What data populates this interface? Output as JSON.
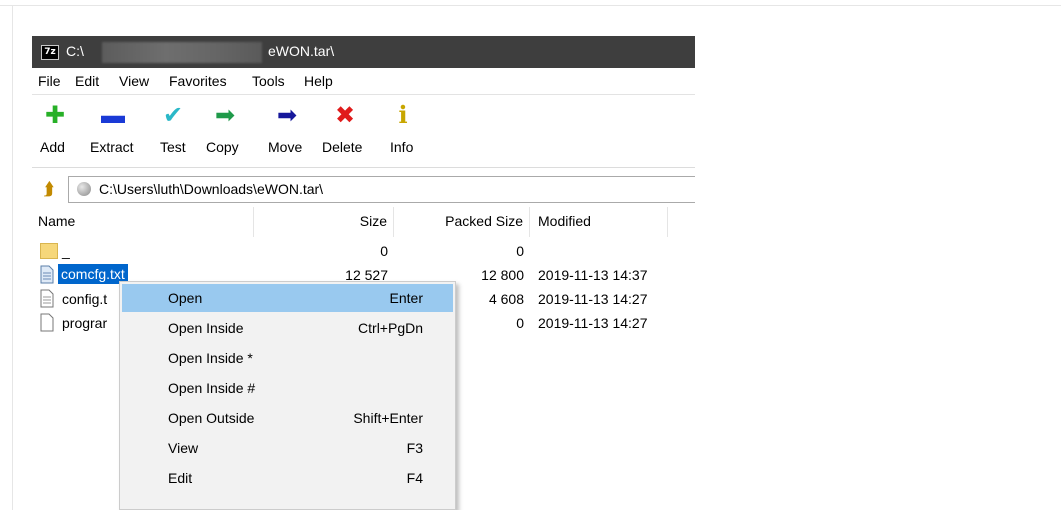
{
  "window": {
    "app_icon_text": "7z",
    "title_prefix": "C:\\",
    "title_suffix": "eWON.tar\\"
  },
  "menu": [
    "File",
    "Edit",
    "View",
    "Favorites",
    "Tools",
    "Help"
  ],
  "toolbar": [
    {
      "label": "Add",
      "icon": "add-icon",
      "glyph": "✚",
      "color": "#27b027"
    },
    {
      "label": "Extract",
      "icon": "extract-icon",
      "glyph": "▬",
      "color": "#1a3ad6"
    },
    {
      "label": "Test",
      "icon": "test-icon",
      "glyph": "✔",
      "color": "#2bb8c8"
    },
    {
      "label": "Copy",
      "icon": "copy-icon",
      "glyph": "➡",
      "color": "#1f9a4a"
    },
    {
      "label": "Move",
      "icon": "move-icon",
      "glyph": "➡",
      "color": "#16189b"
    },
    {
      "label": "Delete",
      "icon": "delete-icon",
      "glyph": "✖",
      "color": "#e01b1b"
    },
    {
      "label": "Info",
      "icon": "info-icon",
      "glyph": "ℹ",
      "color": "#c8a600"
    }
  ],
  "address": {
    "path": "C:\\Users\\luth\\Downloads\\eWON.tar\\"
  },
  "columns": [
    "Name",
    "Size",
    "Packed Size",
    "Modified"
  ],
  "rows": [
    {
      "name": "_",
      "size": "0",
      "packed": "0",
      "modified": "",
      "type": "folder"
    },
    {
      "name": "comcfg.txt",
      "size": "12 527",
      "packed": "12 800",
      "modified": "2019-11-13 14:37",
      "type": "file",
      "selected": true
    },
    {
      "name": "config.t",
      "size": "",
      "packed": "4 608",
      "modified": "2019-11-13 14:27",
      "type": "file"
    },
    {
      "name": "prograr",
      "size": "",
      "packed": "0",
      "modified": "2019-11-13 14:27",
      "type": "file"
    }
  ],
  "context_menu": [
    {
      "label": "Open",
      "shortcut": "Enter",
      "hover": true
    },
    {
      "label": "Open Inside",
      "shortcut": "Ctrl+PgDn"
    },
    {
      "label": "Open Inside *",
      "shortcut": ""
    },
    {
      "label": "Open Inside #",
      "shortcut": ""
    },
    {
      "label": "Open Outside",
      "shortcut": "Shift+Enter"
    },
    {
      "label": "View",
      "shortcut": "F3"
    },
    {
      "label": "Edit",
      "shortcut": "F4"
    }
  ]
}
